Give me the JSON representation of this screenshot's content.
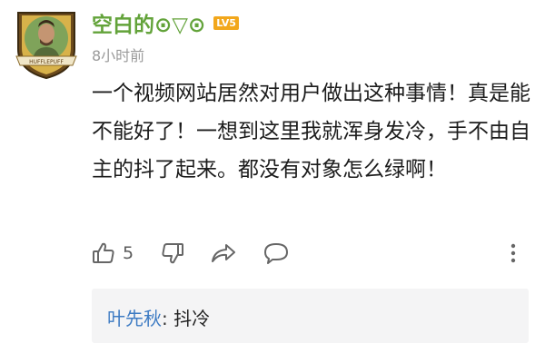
{
  "comment": {
    "username": "空白的⊙▽⊙",
    "level_badge": "LV5",
    "timestamp": "8小时前",
    "avatar_text": "HUFFLEPUFF",
    "body": "一个视频网站居然对用户做出这种事情！真是能不能好了！一想到这里我就浑身发冷，手不由自主的抖了起来。都没有对象怎么绿啊！",
    "actions": {
      "like_count": "5",
      "icons": [
        "thumbs-up-icon",
        "thumbs-down-icon",
        "share-icon",
        "comment-icon",
        "more-vertical-icon"
      ]
    },
    "reply": {
      "author": "叶先秋",
      "separator": ": ",
      "text": "抖冷"
    }
  },
  "colors": {
    "username": "#63a33a",
    "level_badge_bg": "#f2a71b",
    "reply_author": "#3d7bc3",
    "reply_bg": "#f4f4f5",
    "icon": "#666666"
  }
}
